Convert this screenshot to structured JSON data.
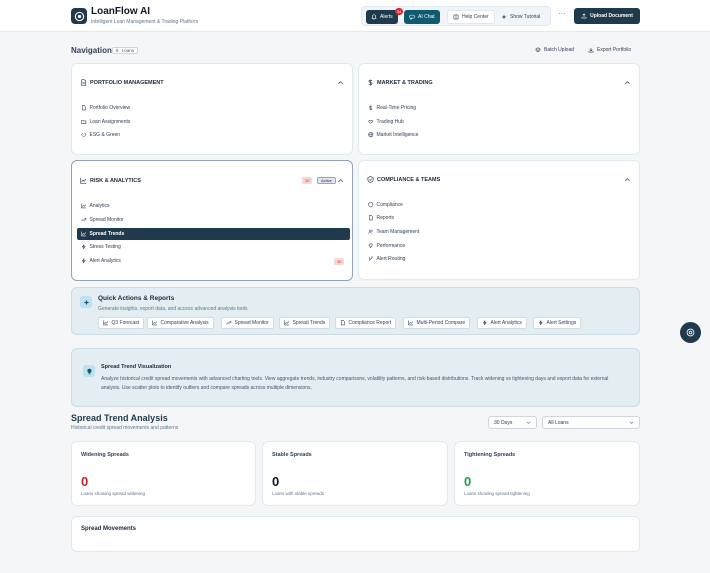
{
  "header": {
    "app_name": "LoanFlow AI",
    "app_subtitle": "Intelligent Loan Management & Trading Platform",
    "alerts_label": "Alerts",
    "alerts_count": "34",
    "ai_chat_label": "AI Chat",
    "help_center_label": "Help Center",
    "show_tutorial_label": "Show Tutorial",
    "more_label": "···",
    "upload_label": "Upload Document"
  },
  "nav": {
    "title": "Navigation",
    "loans_count": "8",
    "loans_label": "Loans",
    "batch_upload_label": "Batch Upload",
    "export_portfolio_label": "Export Portfolio"
  },
  "sections": {
    "portfolio": {
      "title": "PORTFOLIO MANAGEMENT",
      "items": [
        "Portfolio Overview",
        "Loan Assignments",
        "ESG & Green"
      ]
    },
    "market": {
      "title": "MARKET & TRADING",
      "items": [
        "Real-Time Pricing",
        "Trading Hub",
        "Market Intelligence"
      ]
    },
    "risk": {
      "title": "RISK & ANALYTICS",
      "count_badge": "10",
      "active_badge": "Active",
      "items": [
        "Analytics",
        "Spread Monitor",
        "Spread Trends",
        "Stress Testing",
        "Alert Analytics"
      ],
      "alert_analytics_badge": "10"
    },
    "compliance": {
      "title": "COMPLIANCE & TEAMS",
      "items": [
        "Compliance",
        "Reports",
        "Team Management",
        "Performance",
        "Alert Routing"
      ]
    }
  },
  "quick": {
    "title": "Quick Actions & Reports",
    "description": "Generate insights, export data, and access advanced analysis tools",
    "buttons": [
      "Q3 Forecast",
      "Comparative Analysis",
      "Spread Monitor",
      "Spread Trends",
      "Compliance Report",
      "Multi-Period Compare",
      "Alert Analytics",
      "Alert Settings"
    ]
  },
  "info": {
    "title": "Spread Trend Visualization",
    "description": "Analyze historical credit spread movements with advanced charting tools. View aggregate trends, industry comparisons, volatility patterns, and risk-based distributions. Track widening vs tightening days and export data for external analysis. Use scatter plots to identify outliers and compare spreads across multiple dimensions."
  },
  "analysis": {
    "title": "Spread Trend Analysis",
    "subtitle": "Historical credit spread movements and patterns",
    "period_select": "30 Days",
    "loans_select": "All Loans"
  },
  "stats": [
    {
      "title": "Widening Spreads",
      "value": "0",
      "note": "Loans showing spread widening",
      "color": "#c0262d"
    },
    {
      "title": "Stable Spreads",
      "value": "0",
      "note": "Loans with stable spreads",
      "color": "#0f172a"
    },
    {
      "title": "Tightening Spreads",
      "value": "0",
      "note": "Loans showing spread tightening",
      "color": "#16a34a"
    }
  ],
  "movements": {
    "title": "Spread Movements"
  }
}
